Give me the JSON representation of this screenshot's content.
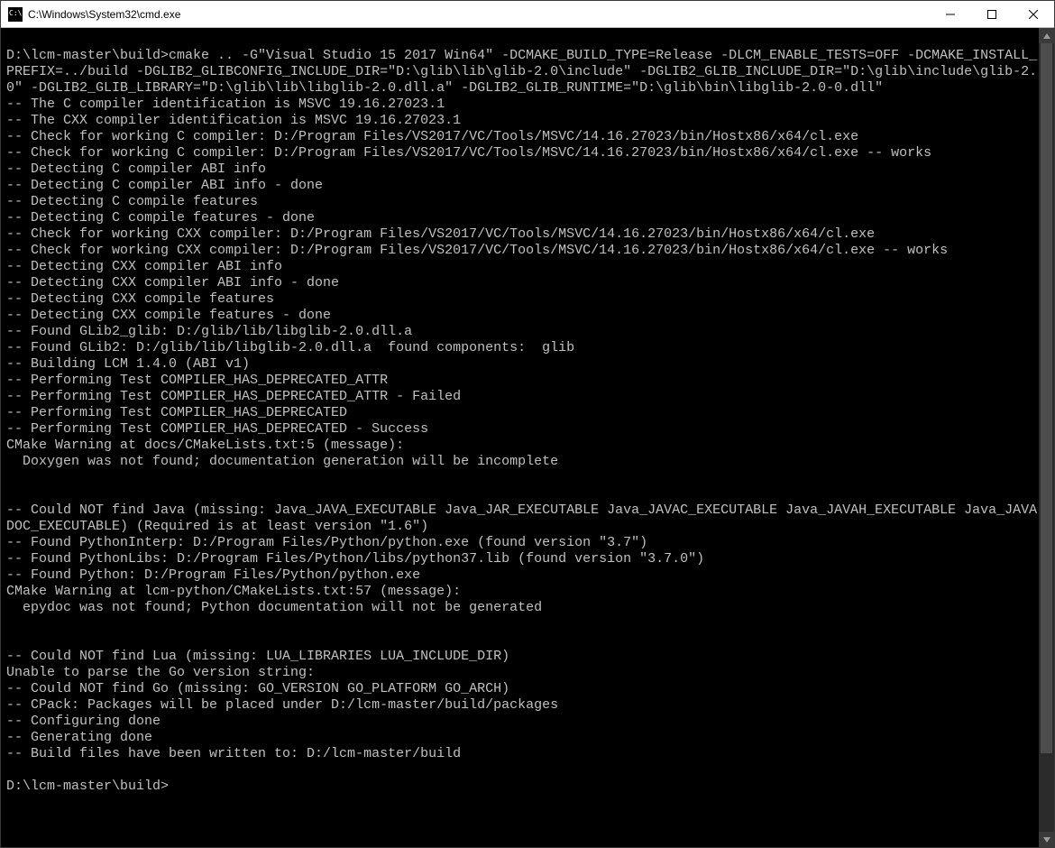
{
  "window": {
    "title": "C:\\Windows\\System32\\cmd.exe",
    "icon_name": "cmd-icon"
  },
  "controls": {
    "minimize": "minimize",
    "maximize": "maximize",
    "close": "close"
  },
  "terminal": {
    "prompt1": "D:\\lcm-master\\build>",
    "command": "cmake .. -G\"Visual Studio 15 2017 Win64\" -DCMAKE_BUILD_TYPE=Release -DLCM_ENABLE_TESTS=OFF -DCMAKE_INSTALL_PREFIX=../build -DGLIB2_GLIBCONFIG_INCLUDE_DIR=\"D:\\glib\\lib\\glib-2.0\\include\" -DGLIB2_GLIB_INCLUDE_DIR=\"D:\\glib\\include\\glib-2.0\" -DGLIB2_GLIB_LIBRARY=\"D:\\glib\\lib\\libglib-2.0.dll.a\" -DGLIB2_GLIB_RUNTIME=\"D:\\glib\\bin\\libglib-2.0-0.dll\"",
    "lines": [
      "-- The C compiler identification is MSVC 19.16.27023.1",
      "-- The CXX compiler identification is MSVC 19.16.27023.1",
      "-- Check for working C compiler: D:/Program Files/VS2017/VC/Tools/MSVC/14.16.27023/bin/Hostx86/x64/cl.exe",
      "-- Check for working C compiler: D:/Program Files/VS2017/VC/Tools/MSVC/14.16.27023/bin/Hostx86/x64/cl.exe -- works",
      "-- Detecting C compiler ABI info",
      "-- Detecting C compiler ABI info - done",
      "-- Detecting C compile features",
      "-- Detecting C compile features - done",
      "-- Check for working CXX compiler: D:/Program Files/VS2017/VC/Tools/MSVC/14.16.27023/bin/Hostx86/x64/cl.exe",
      "-- Check for working CXX compiler: D:/Program Files/VS2017/VC/Tools/MSVC/14.16.27023/bin/Hostx86/x64/cl.exe -- works",
      "-- Detecting CXX compiler ABI info",
      "-- Detecting CXX compiler ABI info - done",
      "-- Detecting CXX compile features",
      "-- Detecting CXX compile features - done",
      "-- Found GLib2_glib: D:/glib/lib/libglib-2.0.dll.a",
      "-- Found GLib2: D:/glib/lib/libglib-2.0.dll.a  found components:  glib",
      "-- Building LCM 1.4.0 (ABI v1)",
      "-- Performing Test COMPILER_HAS_DEPRECATED_ATTR",
      "-- Performing Test COMPILER_HAS_DEPRECATED_ATTR - Failed",
      "-- Performing Test COMPILER_HAS_DEPRECATED",
      "-- Performing Test COMPILER_HAS_DEPRECATED - Success",
      "CMake Warning at docs/CMakeLists.txt:5 (message):",
      "  Doxygen was not found; documentation generation will be incomplete",
      "",
      "",
      "-- Could NOT find Java (missing: Java_JAVA_EXECUTABLE Java_JAR_EXECUTABLE Java_JAVAC_EXECUTABLE Java_JAVAH_EXECUTABLE Java_JAVADOC_EXECUTABLE) (Required is at least version \"1.6\")",
      "-- Found PythonInterp: D:/Program Files/Python/python.exe (found version \"3.7\")",
      "-- Found PythonLibs: D:/Program Files/Python/libs/python37.lib (found version \"3.7.0\")",
      "-- Found Python: D:/Program Files/Python/python.exe",
      "CMake Warning at lcm-python/CMakeLists.txt:57 (message):",
      "  epydoc was not found; Python documentation will not be generated",
      "",
      "",
      "-- Could NOT find Lua (missing: LUA_LIBRARIES LUA_INCLUDE_DIR)",
      "Unable to parse the Go version string:",
      "-- Could NOT find Go (missing: GO_VERSION GO_PLATFORM GO_ARCH)",
      "-- CPack: Packages will be placed under D:/lcm-master/build/packages",
      "-- Configuring done",
      "-- Generating done",
      "-- Build files have been written to: D:/lcm-master/build"
    ],
    "prompt2": "D:\\lcm-master\\build>"
  },
  "colors": {
    "terminal_bg": "#000000",
    "terminal_fg": "#c0c0c0",
    "titlebar_bg": "#ffffff"
  }
}
